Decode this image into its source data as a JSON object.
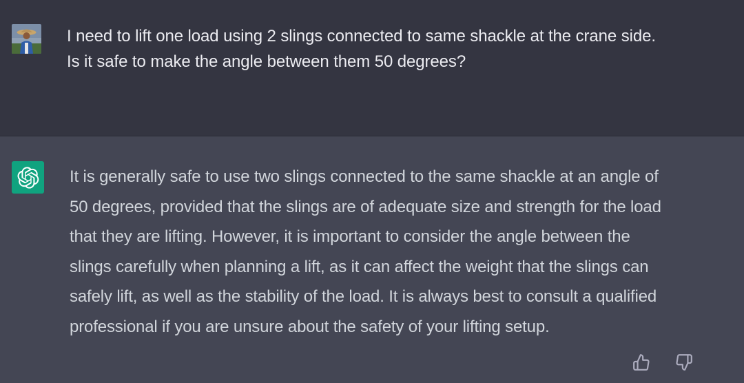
{
  "conversation": {
    "user_message": {
      "avatar_icon": "user-avatar-photo",
      "lines": [
        "I need to lift one load using 2 slings connected to same shackle at the crane side.",
        "Is it safe to make the angle between them 50 degrees?"
      ]
    },
    "assistant_message": {
      "avatar_icon": "openai-logo-icon",
      "avatar_color": "#10a37f",
      "lines": [
        "It is generally safe to use two slings connected to the same shackle at an angle of",
        "50 degrees, provided that the slings are of adequate size and strength for the load",
        "that they are lifting. However, it is important to consider the angle between the",
        "slings carefully when planning a lift, as it can affect the weight that the slings can",
        "safely lift, as well as the stability of the load. It is always best to consult a qualified",
        "professional if you are unsure about the safety of your lifting setup."
      ],
      "feedback_icons": [
        "thumbs-up-icon",
        "thumbs-down-icon"
      ]
    }
  },
  "colors": {
    "user_bg": "#343541",
    "assistant_bg": "#444654",
    "user_text": "#ececf1",
    "assistant_text": "#d1d5db",
    "icon_color": "#acacbe"
  }
}
